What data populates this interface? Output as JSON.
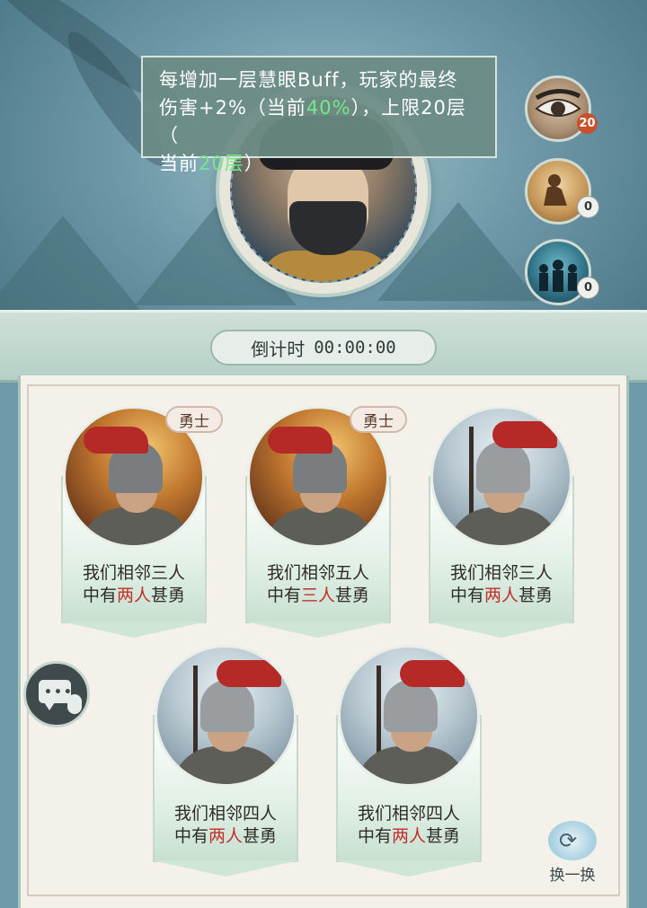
{
  "tooltip": {
    "line1": "每增加一层慧眼Buff，玩家的最终",
    "line2_a": "伤害+2%（当前",
    "line2_current": "40%",
    "line2_b": "），上限20层（",
    "line3_a": "当前",
    "line3_current": "20层",
    "line3_b": "）"
  },
  "side_buttons": [
    {
      "icon": "eye-icon",
      "count": "20"
    },
    {
      "icon": "kneeling-figure-icon",
      "count": "0"
    },
    {
      "icon": "crowd-icon",
      "count": "0"
    }
  ],
  "countdown": {
    "label": "倒计时",
    "time": "00:00:00"
  },
  "cards": [
    {
      "tag": "勇士",
      "line1": "我们相邻三人",
      "line2_a": "中有",
      "line2_red": "两人",
      "line2_b": "甚勇"
    },
    {
      "tag": "勇士",
      "line1": "我们相邻五人",
      "line2_a": "中有",
      "line2_red": "三人",
      "line2_b": "甚勇"
    },
    {
      "tag": "",
      "line1": "我们相邻三人",
      "line2_a": "中有",
      "line2_red": "两人",
      "line2_b": "甚勇"
    },
    {
      "tag": "",
      "line1": "我们相邻四人",
      "line2_a": "中有",
      "line2_red": "两人",
      "line2_b": "甚勇"
    },
    {
      "tag": "",
      "line1": "我们相邻四人",
      "line2_a": "中有",
      "line2_red": "两人",
      "line2_b": "甚勇"
    }
  ],
  "refresh": {
    "label": "换一换"
  },
  "colors": {
    "highlight_green": "#74e88c",
    "highlight_red": "#c0302c",
    "badge_hot": "#c8502a"
  }
}
